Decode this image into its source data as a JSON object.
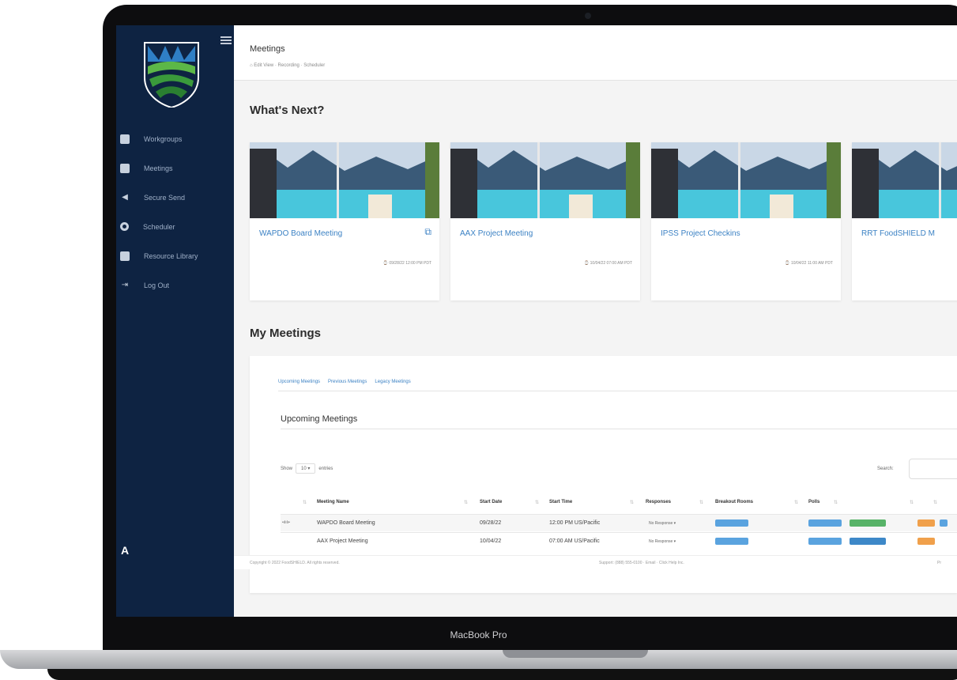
{
  "device": {
    "model_label": "MacBook Pro"
  },
  "sidebar": {
    "items": [
      {
        "label": "Workgroups",
        "icon": "briefcase-icon"
      },
      {
        "label": "Meetings",
        "icon": "video-icon"
      },
      {
        "label": "Secure Send",
        "icon": "send-icon"
      },
      {
        "label": "Scheduler",
        "icon": "clock-icon"
      },
      {
        "label": "Resource Library",
        "icon": "book-icon"
      },
      {
        "label": "Log Out",
        "icon": "logout-icon"
      }
    ],
    "brand_mark": "A"
  },
  "header": {
    "title": "Meetings",
    "breadcrumb": "⌂ Edit View · Recording · Scheduler"
  },
  "whats_next": {
    "title": "What's Next?",
    "cards": [
      {
        "title": "WAPDO Board Meeting",
        "time": "⌚ 09/28/22 12:00 PM PDT"
      },
      {
        "title": "AAX Project Meeting",
        "time": "⌚ 10/04/22 07:00 AM PDT"
      },
      {
        "title": "IPSS Project Checkins",
        "time": "⌚ 10/04/22 11:00 AM PDT"
      },
      {
        "title": "RRT FoodSHIELD M",
        "time": ""
      }
    ]
  },
  "my_meetings": {
    "title": "My Meetings",
    "tabs": [
      "Upcoming Meetings",
      "Previous Meetings",
      "Legacy Meetings"
    ],
    "subtitle": "Upcoming Meetings",
    "show_label": "Show",
    "entries_value": "10",
    "entries_label": "entries",
    "search_label": "Search:",
    "columns": [
      "Meeting Name",
      "Start Date",
      "Start Time",
      "Responses",
      "Breakout Rooms",
      "Polls"
    ],
    "rows": [
      {
        "indicator": "•ılılı•",
        "name": "WAPDO Board Meeting",
        "date": "09/28/22",
        "time": "12:00 PM US/Pacific",
        "response": "No Response ▾"
      },
      {
        "indicator": "",
        "name": "AAX Project Meeting",
        "date": "10/04/22",
        "time": "07:00 AM US/Pacific",
        "response": "No Response ▾"
      }
    ],
    "badge_colors": {
      "blue": "#5aa3df",
      "green": "#58b368",
      "orange": "#f0a04b"
    }
  },
  "footer": {
    "left": "Copyright © 2022 FoodSHIELD. All rights reserved.",
    "middle": "Support: (888) 555-0100 · Email · Click Help Inc.",
    "right": "Pr"
  }
}
